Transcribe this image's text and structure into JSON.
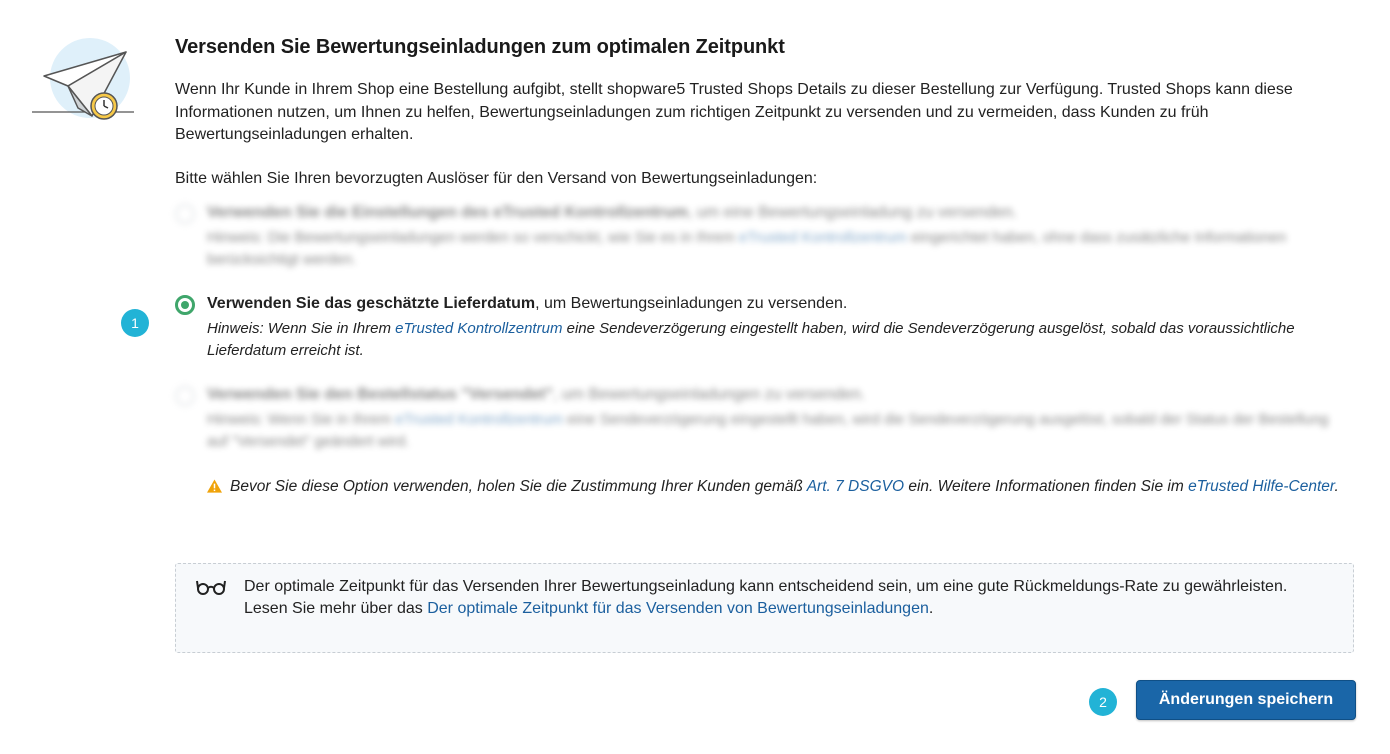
{
  "section": {
    "title": "Versenden Sie Bewertungseinladungen zum optimalen Zeitpunkt",
    "intro": "Wenn Ihr Kunde in Ihrem Shop eine Bestellung aufgibt, stellt shopware5 Trusted Shops Details zu dieser Bestellung zur Verfügung. Trusted Shops kann diese Informationen nutzen, um Ihnen zu helfen, Bewertungseinladungen zum richtigen Zeitpunkt zu versenden und zu vermeiden, dass Kunden zu früh Bewertungseinladungen erhalten.",
    "prompt": "Bitte wählen Sie Ihren bevorzugten Auslöser für den Versand von Bewertungseinladungen:"
  },
  "options": [
    {
      "title_bold": "Verwenden Sie die Einstellungen des eTrusted Kontrollzentrum",
      "title_rest": ", um eine Bewertungseinladung zu versenden.",
      "hint_before": "Hinweis: Die Bewertungseinladungen werden so verschickt, wie Sie es in Ihrem ",
      "hint_link": "eTrusted Kontrollzentrum",
      "hint_after": " eingerichtet haben, ohne dass zusätzliche Informationen berücksichtigt werden."
    },
    {
      "title_bold": "Verwenden Sie das geschätzte Lieferdatum",
      "title_rest": ", um Bewertungseinladungen zu versenden.",
      "hint_before": "Hinweis: Wenn Sie in Ihrem ",
      "hint_link": "eTrusted Kontrollzentrum",
      "hint_after": " eine Sendeverzögerung eingestellt haben, wird die Sendeverzögerung ausgelöst, sobald das voraussichtliche Lieferdatum erreicht ist."
    },
    {
      "title_bold": "Verwenden Sie den Bestellstatus \"Versendet\"",
      "title_rest": ", um Bewertungseinladungen zu versenden.",
      "hint_before": "Hinweis: Wenn Sie in Ihrem ",
      "hint_link": "eTrusted Kontrollzentrum",
      "hint_after": " eine Sendeverzögerung eingestellt haben, wird die Sendeverzögerung ausgelöst, sobald der Status der Bestellung auf \"Versendet\" geändert wird."
    }
  ],
  "warning": {
    "before": "Bevor Sie diese Option verwenden, holen Sie die Zustimmung Ihrer Kunden gemäß ",
    "link1": "Art. 7 DSGVO",
    "middle": " ein. Weitere Informationen finden Sie im ",
    "link2": "eTrusted Hilfe-Center",
    "after": "."
  },
  "info": {
    "line1": "Der optimale Zeitpunkt für das Versenden Ihrer Bewertungseinladung kann entscheidend sein, um eine gute Rückmeldungs-Rate zu gewährleisten.",
    "line2_before": "Lesen Sie mehr über das ",
    "line2_link": "Der optimale Zeitpunkt für das Versenden von Bewertungseinladungen",
    "line2_after": "."
  },
  "badges": {
    "one": "1",
    "two": "2"
  },
  "save_label": "Änderungen speichern",
  "colors": {
    "accent": "#1a66a8",
    "radio_active": "#3fa66b",
    "badge": "#22b3d6",
    "link": "#1b5f9e",
    "warning": "#f0a30a"
  },
  "icons": {
    "illustration": "paper-plane-clock-icon",
    "warning": "warning-triangle-icon",
    "info": "glasses-icon"
  }
}
